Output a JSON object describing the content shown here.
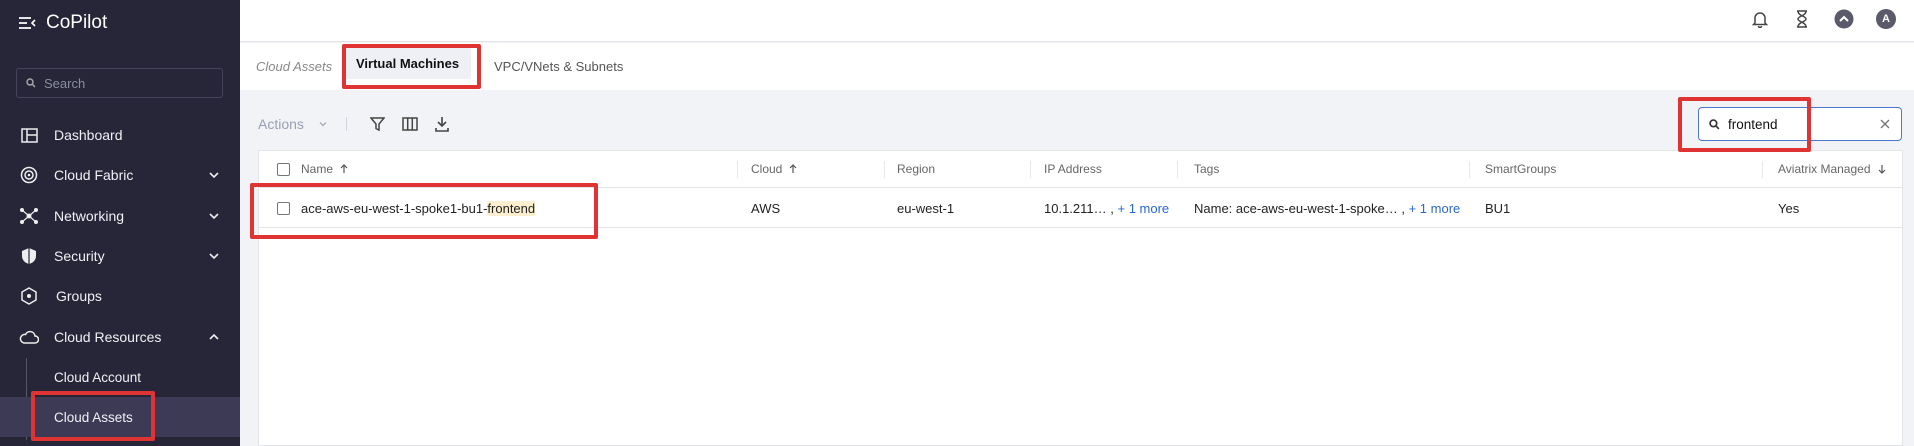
{
  "app": {
    "title": "CoPilot"
  },
  "sidebar": {
    "search_placeholder": "Search",
    "items": [
      {
        "label": "Dashboard",
        "icon": "dashboard-icon",
        "expandable": false
      },
      {
        "label": "Cloud Fabric",
        "icon": "cloud-fabric-icon",
        "expandable": true
      },
      {
        "label": "Networking",
        "icon": "networking-icon",
        "expandable": true
      },
      {
        "label": "Security",
        "icon": "shield-icon",
        "expandable": true
      },
      {
        "label": "Groups",
        "icon": "groups-icon",
        "expandable": false
      },
      {
        "label": "Cloud Resources",
        "icon": "cloud-icon",
        "expandable": true,
        "expanded": true
      }
    ],
    "sub_items": [
      {
        "label": "Cloud Account"
      },
      {
        "label": "Cloud Assets",
        "active": true
      }
    ]
  },
  "topbar": {
    "icons": [
      "bell-icon",
      "hourglass-icon",
      "chevron-up-circle-icon",
      "avatar"
    ],
    "avatar_initial": "A"
  },
  "tabs": [
    {
      "label": "Cloud Assets",
      "style": "breadcrumb"
    },
    {
      "label": "Virtual Machines",
      "active": true
    },
    {
      "label": "VPC/VNets & Subnets"
    }
  ],
  "toolbar": {
    "actions_label": "Actions",
    "icons": [
      "filter-icon",
      "columns-icon",
      "download-icon"
    ]
  },
  "search": {
    "value": "frontend"
  },
  "table": {
    "columns": [
      {
        "label": "Name",
        "sort": "asc"
      },
      {
        "label": "Cloud",
        "sort": "asc"
      },
      {
        "label": "Region"
      },
      {
        "label": "IP Address"
      },
      {
        "label": "Tags"
      },
      {
        "label": "SmartGroups"
      },
      {
        "label": "Aviatrix Managed",
        "sort": "desc"
      }
    ],
    "rows": [
      {
        "name_prefix": "ace-aws-eu-west-1-spoke1-bu1-",
        "name_match": "frontend",
        "cloud": "AWS",
        "region": "eu-west-1",
        "ip": "10.1.211… ,",
        "ip_more": "+ 1 more",
        "tags": "Name: ace-aws-eu-west-1-spoke… ,",
        "tags_more": "+ 1 more",
        "smartgroups": "BU1",
        "managed": "Yes"
      }
    ]
  },
  "colors": {
    "sidebar_bg": "#262638",
    "accent": "#2a66d6",
    "highlight_box": "#e03333"
  }
}
